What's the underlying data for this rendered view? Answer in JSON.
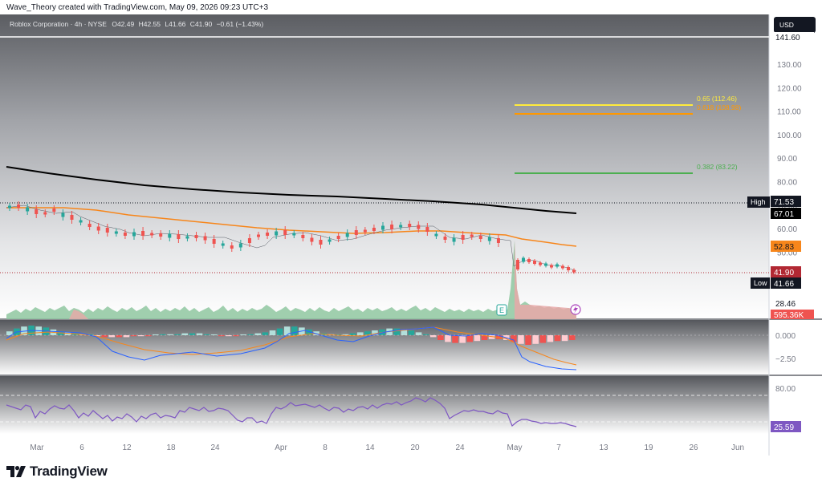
{
  "header": {
    "caption": "Wave_Theory created with TradingView.com, May 09, 2026 09:23 UTC+3"
  },
  "legend": {
    "symbol": "Roblox Corporation · 4h · NYSE",
    "o_label": "O",
    "o": "42.49",
    "h_label": "H",
    "h": "42.55",
    "l_label": "L",
    "l": "41.66",
    "c_label": "C",
    "c": "41.90",
    "change": "−0.61 (−1.43%)"
  },
  "currency": "USD",
  "price_axis": {
    "ticks": [
      "130.00",
      "120.00",
      "110.00",
      "100.00",
      "90.00",
      "80.00",
      "70.00",
      "60.00",
      "50.00"
    ],
    "tags": {
      "top": "141.60",
      "high_label": "High",
      "high": "71.53",
      "ema": "67.01",
      "ma": "52.83",
      "last": "41.90",
      "low_label": "Low",
      "low": "41.66",
      "vol_low": "28.46",
      "volume": "595.36K"
    }
  },
  "fib": {
    "l065": "0.65 (112.46)",
    "l0618": "0.618 (108.98)",
    "l0382": "0.382 (83.22)"
  },
  "macd_axis": {
    "ticks": [
      "0.000",
      "−2.50"
    ]
  },
  "rsi_axis": {
    "ticks": [
      "80.00"
    ],
    "value": "25.59"
  },
  "time_axis": {
    "labels": [
      "Mar",
      "6",
      "12",
      "18",
      "24",
      "Apr",
      "8",
      "14",
      "20",
      "24",
      "May",
      "7",
      "13",
      "19",
      "26",
      "Jun"
    ]
  },
  "markers": {
    "earnings": "E"
  },
  "colors": {
    "up": "#26a69a",
    "down": "#ef5350",
    "ema200": "#000000",
    "ma50": "#f7861b",
    "fib065": "#ffeb3b",
    "fib0618": "#ff9800",
    "fib0382": "#4caf50",
    "rsi": "#7e57c2",
    "macd": "#2962ff"
  },
  "brand": {
    "name": "TradingView"
  },
  "chart_data": {
    "type": "line",
    "title": "Roblox Corporation · 4h · NYSE",
    "x": [
      "Mar",
      "6",
      "12",
      "18",
      "24",
      "Apr",
      "8",
      "14",
      "20",
      "24",
      "May",
      "7"
    ],
    "series": [
      {
        "name": "Price",
        "values": [
          68,
          62,
          58,
          56,
          55,
          54,
          58,
          57,
          60,
          62,
          50,
          46
        ]
      }
    ],
    "ylim": [
      28.46,
      141.6
    ]
  }
}
